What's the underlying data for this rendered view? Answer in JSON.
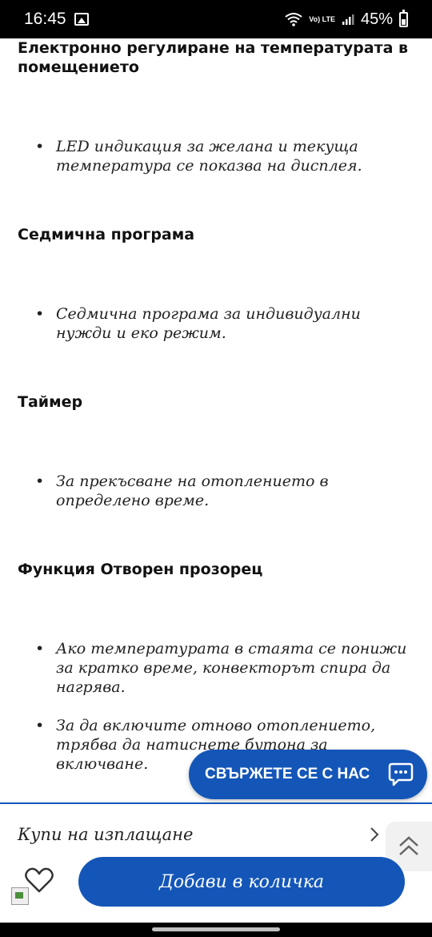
{
  "status_bar": {
    "time": "16:45",
    "signal_label": "Vo) LTE",
    "battery": "45%"
  },
  "sections": [
    {
      "heading": "Електронно регулиране на температурата в помещението",
      "bullets": [
        "LED индикация за желана и текуща температура се показва на дисплея."
      ]
    },
    {
      "heading": "Седмична програма",
      "bullets": [
        "Седмична програма за индивидуални нужди и еко режим."
      ]
    },
    {
      "heading": "Таймер",
      "bullets": [
        "За прекъсване на отоплението в определено време."
      ]
    },
    {
      "heading": "Функция Отворен прозорец",
      "bullets": [
        "Ако температурата в стаята се понижи за кратко време, конвекторът спира да нагрява.",
        "За да включите отново отоплението, трябва да натиснете бутона за включване."
      ]
    }
  ],
  "contact_button": {
    "label": "СВЪРЖЕТЕ СЕ С НАС",
    "icon": "chat-icon"
  },
  "bottom_bar": {
    "installment_label": "Купи на изплащане",
    "add_to_cart_label": "Добави в количка",
    "wishlist_icon": "heart-icon",
    "scroll_top_icon": "double-chevron-up-icon"
  },
  "colors": {
    "accent": "#1456b8"
  }
}
